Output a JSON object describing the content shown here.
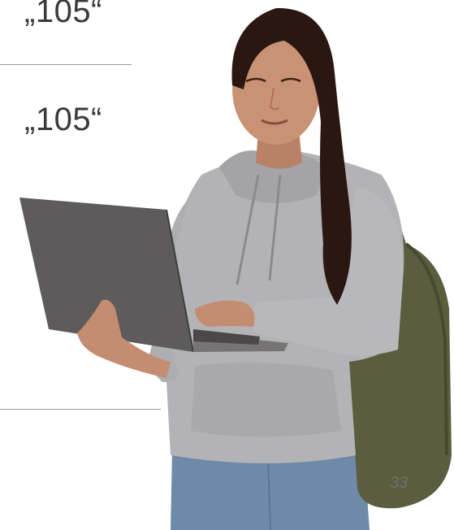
{
  "slide": {
    "value_top": "„105“",
    "value_middle": "„105“",
    "page_number": "33"
  },
  "photo": {
    "subject": "student-with-laptop-and-backpack",
    "colors": {
      "hoodie": "#b3b3b5",
      "hair": "#2a1712",
      "skin": "#c99275",
      "laptop": "#5d5b5c",
      "backpack": "#5a5e3e",
      "jeans": "#6f8aa8"
    }
  }
}
